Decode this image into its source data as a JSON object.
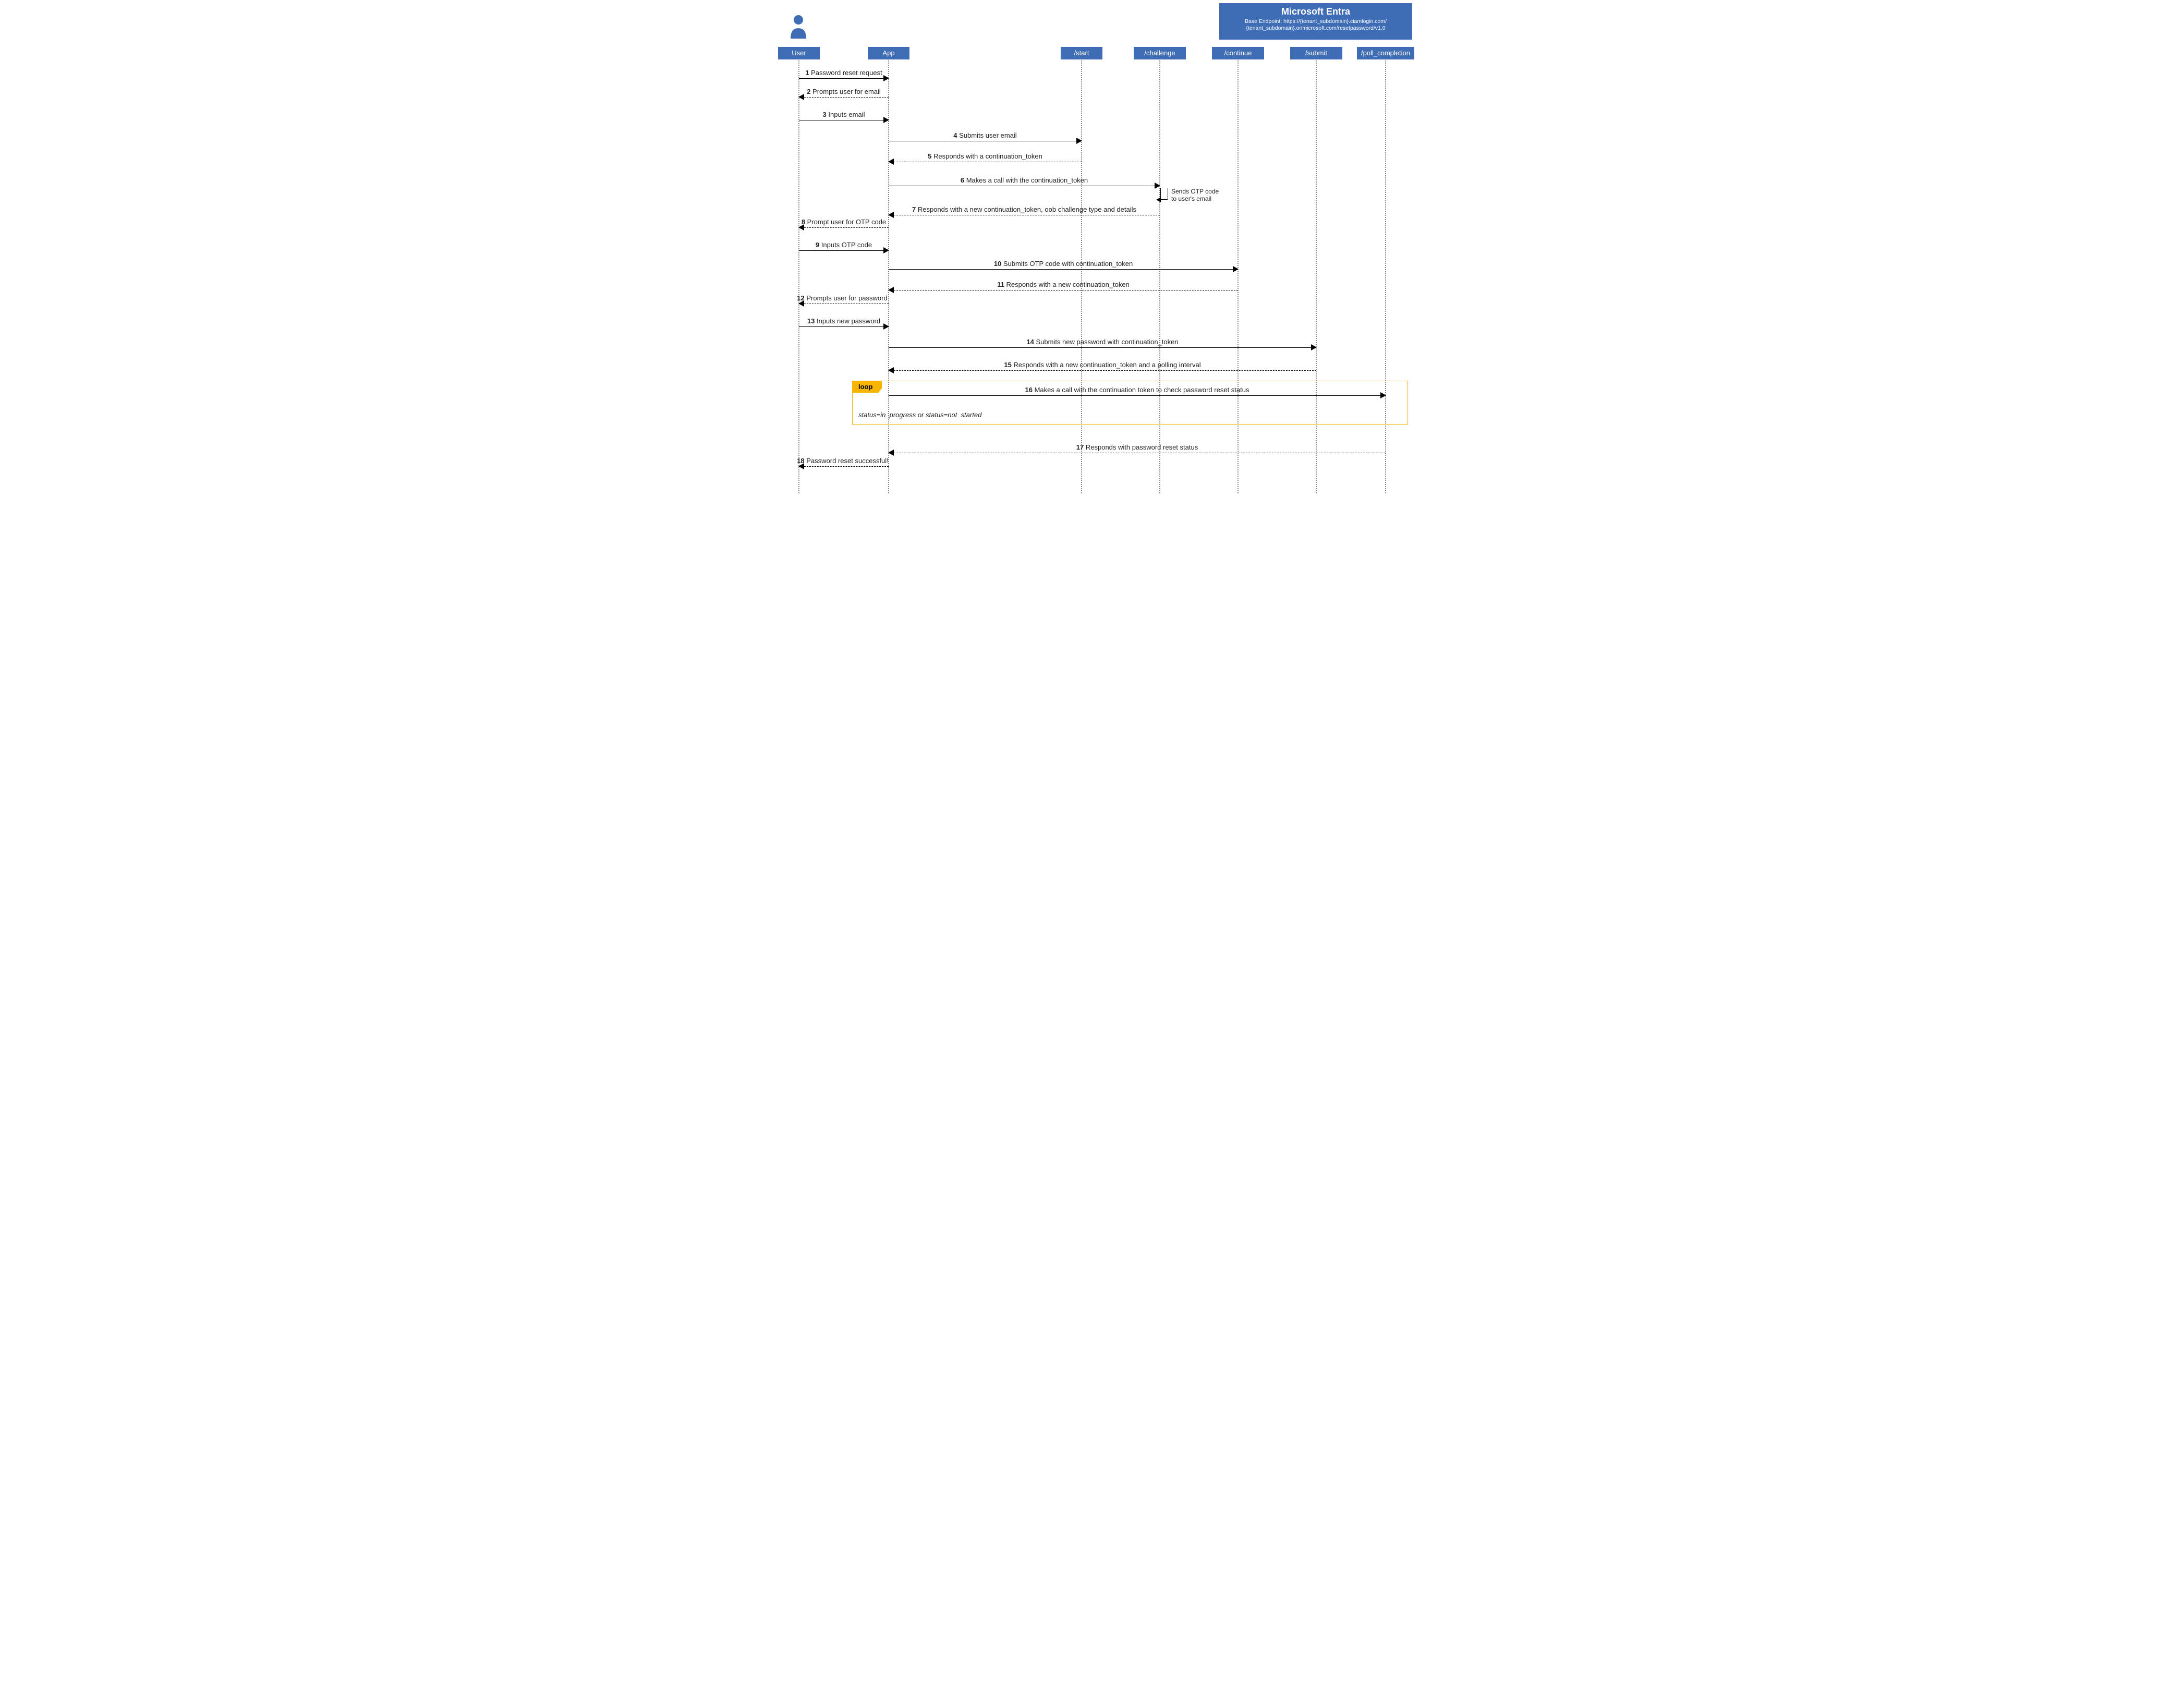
{
  "banner": {
    "title": "Microsoft Entra",
    "line1": "Base Endpoint: https://{tenant_subdomain}.ciamlogin.com/",
    "line2": "{tenant_subdomain}.onmicrosoft.com/resetpassword/v1.0"
  },
  "participants": {
    "user": {
      "label": "User"
    },
    "app": {
      "label": "App"
    },
    "start": {
      "label": "/start"
    },
    "challenge": {
      "label": "/challenge"
    },
    "continue": {
      "label": "/continue"
    },
    "submit": {
      "label": "/submit"
    },
    "poll": {
      "label": "/poll_completion"
    }
  },
  "selfnote": {
    "l1": "Sends OTP code",
    "l2": "to user's email"
  },
  "loop": {
    "tag": "loop",
    "condition": "status=in_progress or status=not_started"
  },
  "messages": {
    "m1": {
      "n": "1",
      "t": "Password reset request"
    },
    "m2": {
      "n": "2",
      "t": "Prompts user for email"
    },
    "m3": {
      "n": "3",
      "t": "Inputs email"
    },
    "m4": {
      "n": "4",
      "t": "Submits user email"
    },
    "m5": {
      "n": "5",
      "t": "Responds with a continuation_token"
    },
    "m6": {
      "n": "6",
      "t": "Makes a call with the continuation_token"
    },
    "m7": {
      "n": "7",
      "t": "Responds with a new continuation_token, oob challenge type and details"
    },
    "m8": {
      "n": "8",
      "t": "Prompt user for OTP code"
    },
    "m9": {
      "n": "9",
      "t": "Inputs OTP code"
    },
    "m10": {
      "n": "10",
      "t": "Submits OTP code with continuation_token"
    },
    "m11": {
      "n": "11",
      "t": "Responds with a new continuation_token"
    },
    "m12": {
      "n": "12",
      "t": "Prompts user for password"
    },
    "m13": {
      "n": "13",
      "t": "Inputs new password"
    },
    "m14": {
      "n": "14",
      "t": "Submits new password with continuation_token"
    },
    "m15": {
      "n": "15",
      "t": "Responds with a new continuation_token and a polling interval"
    },
    "m16": {
      "n": "16",
      "t": "Makes a call with the continuation token to check password reset status"
    },
    "m17": {
      "n": "17",
      "t": "Responds with password reset status"
    },
    "m18": {
      "n": "18",
      "t": "Password reset successful!"
    }
  }
}
